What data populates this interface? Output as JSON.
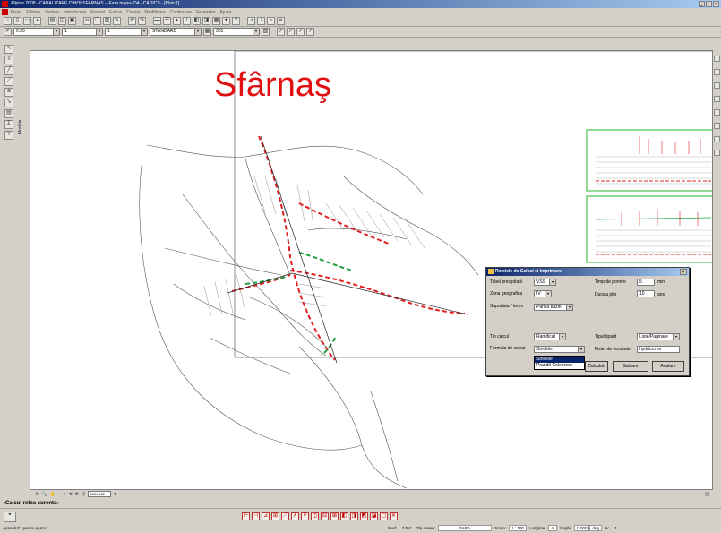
{
  "window": {
    "title": "Allplan 2008 - CANALIZARE CIHOI-SFARNAS - -Fara mapa-/D4 - CADICS - [Plan:1]"
  },
  "menu": [
    "Fisier",
    "Editare",
    "Vedere",
    "Introducere",
    "Format",
    "Extras",
    "Creare",
    "Modificare",
    "Continuare",
    "Fereastra",
    "Ajutor"
  ],
  "format_bar": {
    "pen": "0.35",
    "line": "1",
    "color": "1",
    "layer": "STANDARD",
    "pattern": "301"
  },
  "drawing": {
    "title": "Sfârnaş"
  },
  "sidebar": {
    "module_label": "Module"
  },
  "viewbar": {
    "coord": "5559.552"
  },
  "command_line": "‹Calcul retea curenta›",
  "status": {
    "help": "Apasati F1 pentru Ajutor.",
    "mod_label": "Mod:",
    "mod_value": "7 Pct",
    "tip_desen_label": "Tip desen:",
    "tip_desen_value": "FARA",
    "scara_label": "Scara:",
    "scara_value": "1 : 100",
    "lungime_label": "Lungime:",
    "lungime_unit": "m",
    "unghi_label": "Unghi:",
    "unghi_value": "0.000",
    "unghi_unit": "deg",
    "pct_label": "%:",
    "pct_value": "1"
  },
  "dialog": {
    "title": "Retelele de Calcul si Imprimare",
    "tabel_label": "Tabel precipitatii",
    "tabel_value": "VSS",
    "zona_label": "Zona geografica",
    "zona_value": "IV",
    "suprafata_label": "Suprafata / teren",
    "suprafata_value": "Pantia bazin",
    "timp_label": "Timp de pornire",
    "timp_value": "5",
    "timp_unit": "min",
    "durata_label": "Durata ploi",
    "durata_value": "10",
    "durata_unit": "ans",
    "tip_calcul_label": "Tip calcul",
    "tip_calcul_value": "Ramificat",
    "formula_label": "Formula de calcul",
    "formula_value": "Strickler",
    "formula_options": [
      "Strickler",
      "Prandtl-Colebrook"
    ],
    "tipul_tiparit_label": "Tipul tiparit",
    "tipul_tiparit_value": "Liste/Paginare",
    "fisier_label": "Fisier de rezultate",
    "fisier_value": "hydrics.res",
    "calculeaza": "Calculati",
    "salvare": "Salvare",
    "anulare": "Anulare"
  },
  "colors": {
    "title_red": "#e01010",
    "panel_green": "#6fcf6f",
    "pipe_red": "#e02020",
    "pipe_green": "#20a040"
  }
}
